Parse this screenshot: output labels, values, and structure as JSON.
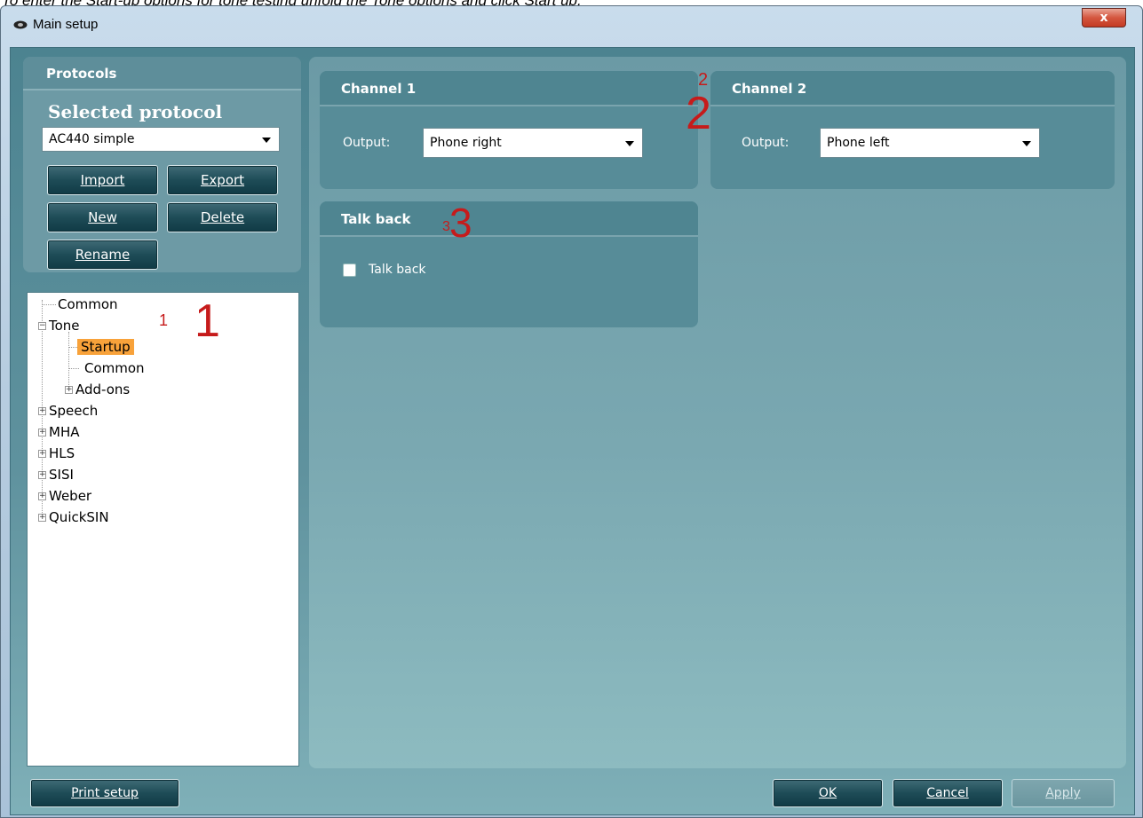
{
  "doc": {
    "instruction": "To enter the Start-up options for tone testing unfold the Tone options and click Start up."
  },
  "window": {
    "title": "Main setup",
    "close_label": "x"
  },
  "protocols": {
    "header": "Protocols",
    "selected_label": "Selected protocol",
    "selected_value": "AC440 simple",
    "buttons": {
      "import": "Import",
      "export": "Export",
      "new": "New",
      "delete": "Delete",
      "rename": "Rename"
    }
  },
  "tree": {
    "items": [
      {
        "label": "Common"
      },
      {
        "label": "Tone"
      },
      {
        "label": "Startup"
      },
      {
        "label": "Common"
      },
      {
        "label": "Add-ons"
      },
      {
        "label": "Speech"
      },
      {
        "label": "MHA"
      },
      {
        "label": "HLS"
      },
      {
        "label": "SISI"
      },
      {
        "label": "Weber"
      },
      {
        "label": "QuickSIN"
      }
    ],
    "selected": "Startup"
  },
  "annotations": {
    "a1_small": "1",
    "a1_large": "1",
    "a2_small": "2",
    "a2_large": "2",
    "a3_small": "3",
    "a3_large": "3"
  },
  "channel1": {
    "title": "Channel 1",
    "output_label": "Output:",
    "output_value": "Phone right"
  },
  "channel2": {
    "title": "Channel 2",
    "output_label": "Output:",
    "output_value": "Phone left"
  },
  "talkback": {
    "title": "Talk back",
    "checkbox_label": "Talk back",
    "checked": false
  },
  "footer": {
    "print_setup": "Print setup",
    "ok": "OK",
    "cancel": "Cancel",
    "apply": "Apply"
  }
}
